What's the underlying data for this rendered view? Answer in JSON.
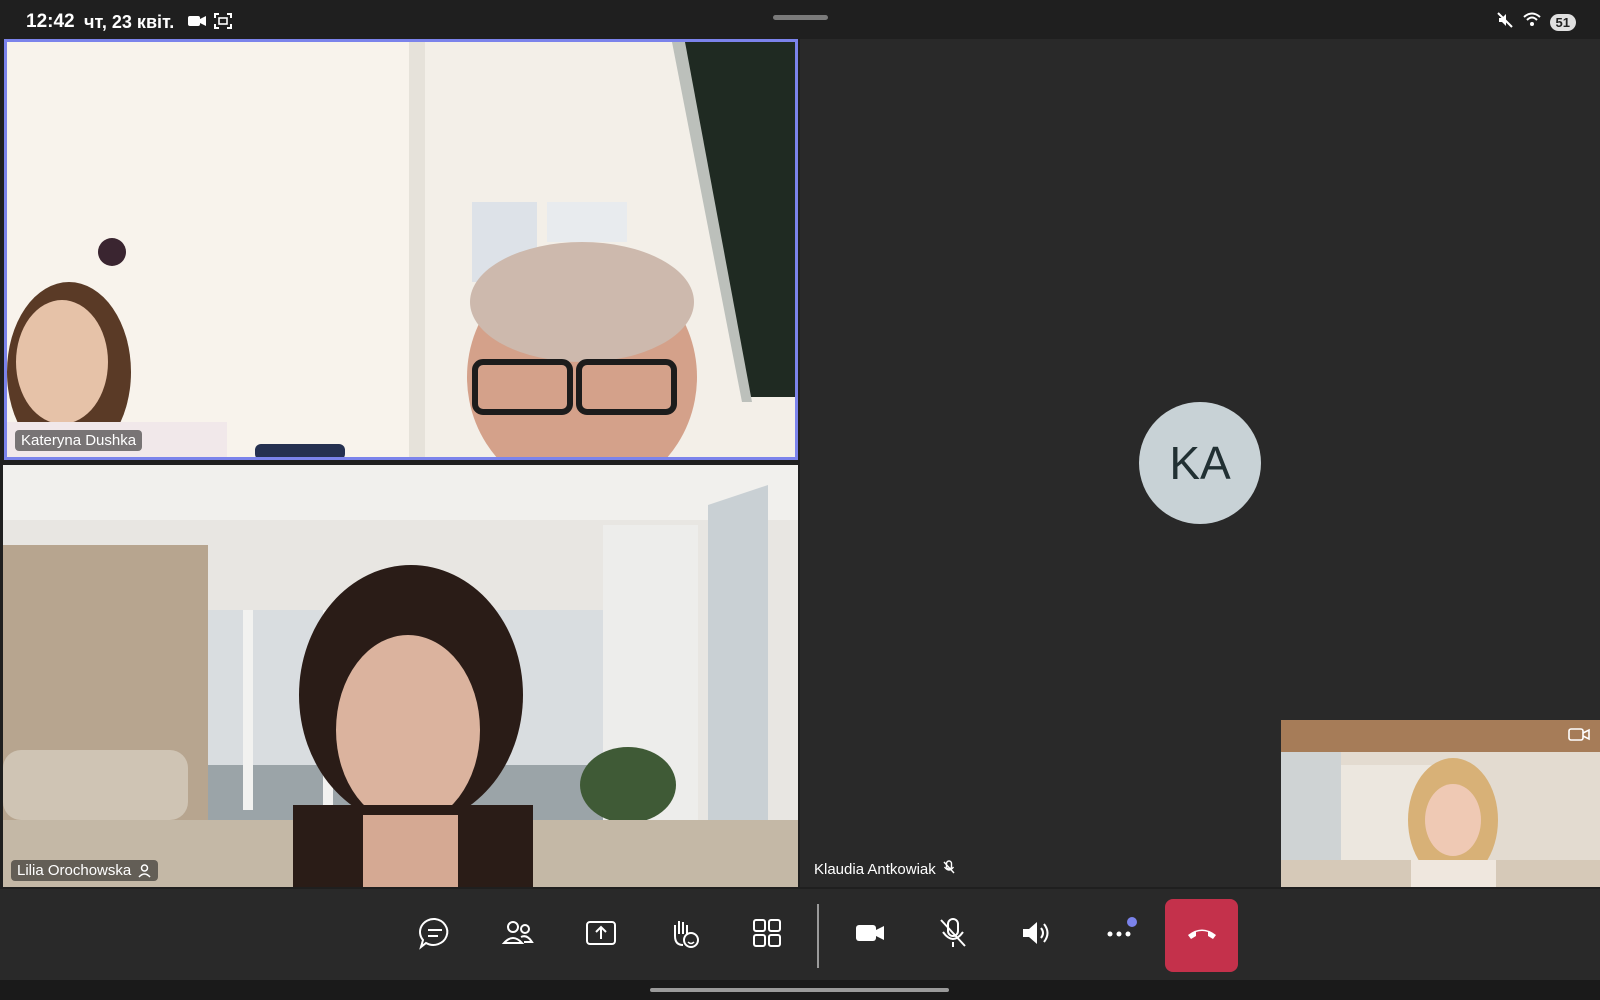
{
  "status_bar": {
    "time": "12:42",
    "date": "чт, 23 квіт.",
    "battery": "51",
    "icons": [
      "camera-icon",
      "screenshot-icon",
      "mute-icon",
      "wifi-icon",
      "battery-icon"
    ]
  },
  "participants": {
    "kateryna": {
      "name": "Kateryna Dushka"
    },
    "lilia": {
      "name": "Lilia Orochowska"
    },
    "klaudia": {
      "name": "Klaudia Antkowiak",
      "initials": "KA"
    }
  },
  "controls": [
    {
      "name": "chat-button",
      "icon": "chat-icon"
    },
    {
      "name": "people-button",
      "icon": "people-icon"
    },
    {
      "name": "share-button",
      "icon": "share-icon"
    },
    {
      "name": "react-button",
      "icon": "raise-hand-icon"
    },
    {
      "name": "view-button",
      "icon": "grid-icon"
    },
    {
      "name": "camera-button",
      "icon": "video-icon"
    },
    {
      "name": "mic-button",
      "icon": "mic-off-icon"
    },
    {
      "name": "speaker-button",
      "icon": "speaker-icon"
    },
    {
      "name": "more-button",
      "icon": "more-icon"
    },
    {
      "name": "hang-up-button",
      "icon": "hang-up-icon"
    }
  ],
  "colors": {
    "accent": "#7b83eb",
    "end_call": "#c4314b",
    "background": "#1f1f1f",
    "avatar_bg": "#c8d2d6"
  }
}
